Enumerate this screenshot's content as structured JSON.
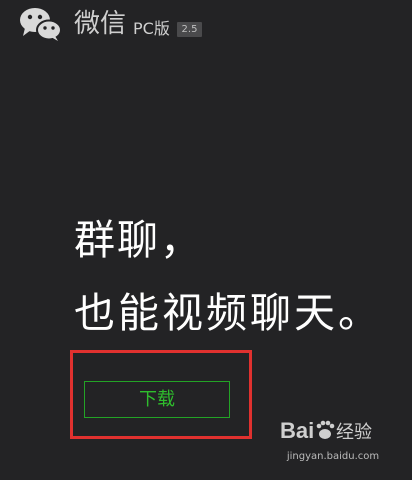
{
  "header": {
    "app_name": "微信",
    "edition": "PC版",
    "version": "2.5"
  },
  "hero": {
    "line1": "群聊，",
    "line2": "也能视频聊天。"
  },
  "download_button": {
    "label": "下载"
  },
  "watermark": {
    "brand": "Baidu经验",
    "url": "jingyan.baidu.com"
  },
  "colors": {
    "background": "#232325",
    "accent_green": "#2fbd2d",
    "highlight_red": "#e0312f"
  },
  "icons": {
    "logo": "wechat-logo-icon"
  }
}
